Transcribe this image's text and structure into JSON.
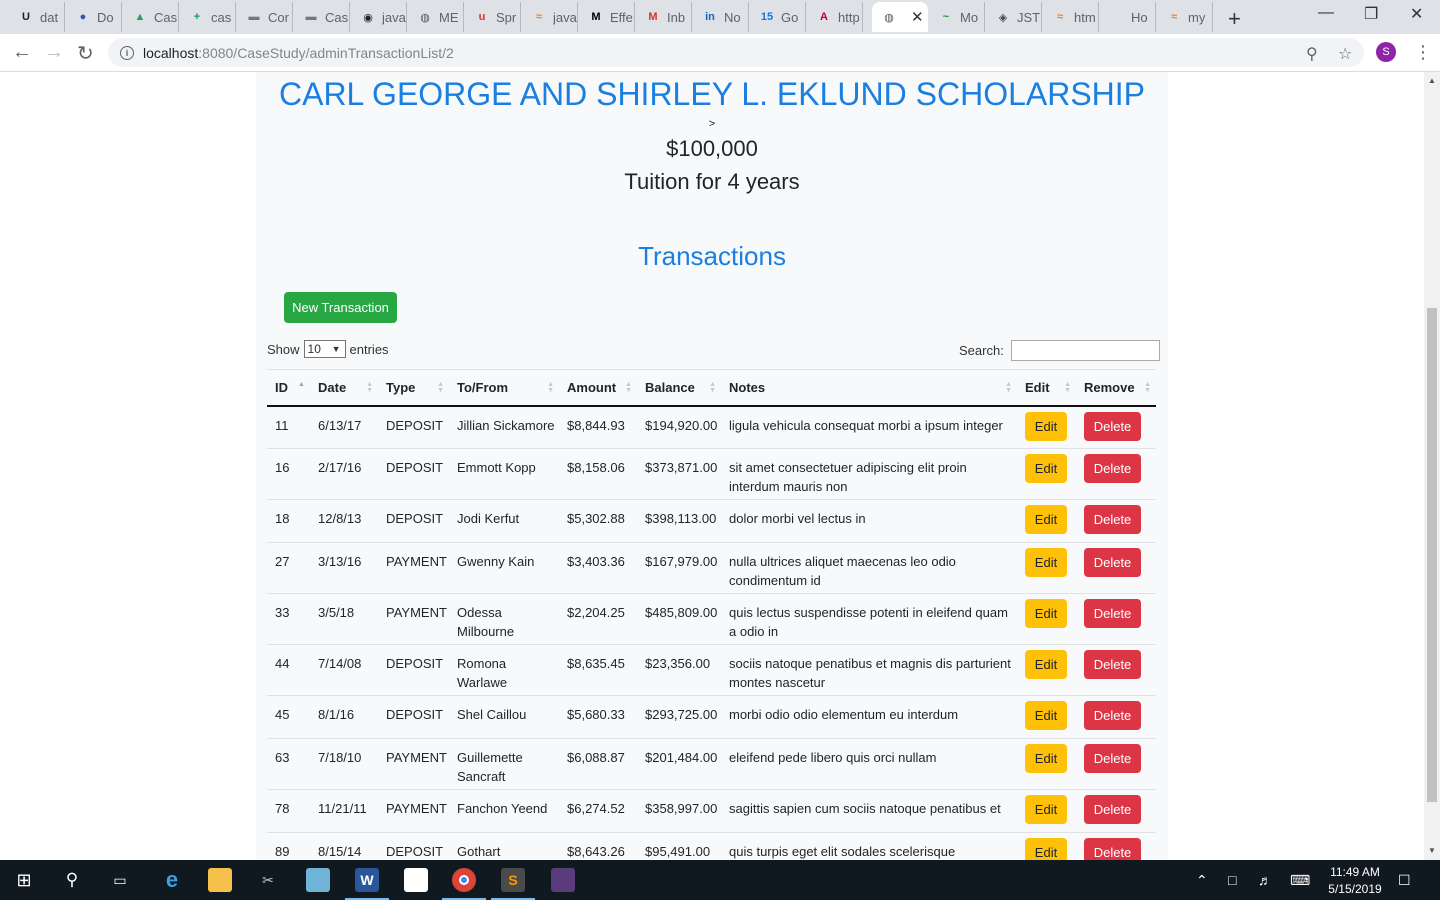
{
  "browser": {
    "tabs": [
      {
        "title": "dat",
        "icon": "U",
        "color": "#222222"
      },
      {
        "title": "Do",
        "icon": "●",
        "color": "#3b4fb8"
      },
      {
        "title": "Cas",
        "icon": "▲",
        "color": "#1fa463"
      },
      {
        "title": "cas",
        "icon": "+",
        "color": "#0f9d58"
      },
      {
        "title": "Cor",
        "icon": "▬",
        "color": "#777777"
      },
      {
        "title": "Cas",
        "icon": "▬",
        "color": "#777777"
      },
      {
        "title": "java",
        "icon": "◉",
        "color": "#222222"
      },
      {
        "title": "ME",
        "icon": "◍",
        "color": "#555555"
      },
      {
        "title": "Spr",
        "icon": "u",
        "color": "#e0322a"
      },
      {
        "title": "java",
        "icon": "≈",
        "color": "#f48024"
      },
      {
        "title": "Effe",
        "icon": "M",
        "color": "#000000"
      },
      {
        "title": "Inb",
        "icon": "M",
        "color": "#d93025"
      },
      {
        "title": "No",
        "icon": "in",
        "color": "#0a66c2"
      },
      {
        "title": "Go",
        "icon": "15",
        "color": "#1a73e8"
      },
      {
        "title": "http",
        "icon": "A",
        "color": "#c3002f"
      },
      {
        "title": "",
        "icon": "◍",
        "color": "#555555",
        "active": true
      },
      {
        "title": "Mo",
        "icon": "~",
        "color": "#1a8f3c"
      },
      {
        "title": "JST",
        "icon": "◈",
        "color": "#444444"
      },
      {
        "title": "htm",
        "icon": "≈",
        "color": "#f48024"
      },
      {
        "title": "Ho",
        "icon": "",
        "color": "#555555"
      },
      {
        "title": "my",
        "icon": "≈",
        "color": "#f48024"
      }
    ],
    "url_host": "localhost",
    "url_path": ":8080/CaseStudy/adminTransactionList/2",
    "profile_initial": "S"
  },
  "scholarship": {
    "title": "CARL GEORGE AND SHIRLEY L. EKLUND SCHOLARSHIP",
    "caret": ">",
    "amount": "$100,000",
    "description": "Tuition for 4 years"
  },
  "transactions": {
    "heading": "Transactions",
    "new_button": "New Transaction",
    "show_label": "Show",
    "entries_value": "10",
    "entries_label": "entries",
    "search_label": "Search:",
    "search_value": "",
    "columns": [
      "ID",
      "Date",
      "Type",
      "To/From",
      "Amount",
      "Balance",
      "Notes",
      "Edit",
      "Remove"
    ],
    "edit_label": "Edit",
    "delete_label": "Delete",
    "rows": [
      {
        "id": "11",
        "date": "6/13/17",
        "type": "DEPOSIT",
        "party": "Jillian Sickamore",
        "amount": "$8,844.93",
        "balance": "$194,920.00",
        "notes": "ligula vehicula consequat morbi a ipsum integer"
      },
      {
        "id": "16",
        "date": "2/17/16",
        "type": "DEPOSIT",
        "party": "Emmott Kopp",
        "amount": "$8,158.06",
        "balance": "$373,871.00",
        "notes": "sit amet consectetuer adipiscing elit proin interdum mauris non"
      },
      {
        "id": "18",
        "date": "12/8/13",
        "type": "DEPOSIT",
        "party": "Jodi Kerfut",
        "amount": "$5,302.88",
        "balance": "$398,113.00",
        "notes": "dolor morbi vel lectus in"
      },
      {
        "id": "27",
        "date": "3/13/16",
        "type": "PAYMENT",
        "party": "Gwenny Kain",
        "amount": "$3,403.36",
        "balance": "$167,979.00",
        "notes": "nulla ultrices aliquet maecenas leo odio condimentum id"
      },
      {
        "id": "33",
        "date": "3/5/18",
        "type": "PAYMENT",
        "party": "Odessa Milbourne",
        "amount": "$2,204.25",
        "balance": "$485,809.00",
        "notes": "quis lectus suspendisse potenti in eleifend quam a odio in"
      },
      {
        "id": "44",
        "date": "7/14/08",
        "type": "DEPOSIT",
        "party": "Romona Warlawe",
        "amount": "$8,635.45",
        "balance": "$23,356.00",
        "notes": "sociis natoque penatibus et magnis dis parturient montes nascetur"
      },
      {
        "id": "45",
        "date": "8/1/16",
        "type": "DEPOSIT",
        "party": "Shel Caillou",
        "amount": "$5,680.33",
        "balance": "$293,725.00",
        "notes": "morbi odio odio elementum eu interdum"
      },
      {
        "id": "63",
        "date": "7/18/10",
        "type": "PAYMENT",
        "party": "Guillemette Sancraft",
        "amount": "$6,088.87",
        "balance": "$201,484.00",
        "notes": "eleifend pede libero quis orci nullam"
      },
      {
        "id": "78",
        "date": "11/21/11",
        "type": "PAYMENT",
        "party": "Fanchon Yeend",
        "amount": "$6,274.52",
        "balance": "$358,997.00",
        "notes": "sagittis sapien cum sociis natoque penatibus et"
      },
      {
        "id": "89",
        "date": "8/15/14",
        "type": "DEPOSIT",
        "party": "Gothart",
        "amount": "$8,643.26",
        "balance": "$95,491.00",
        "notes": "quis turpis eget elit sodales scelerisque"
      }
    ]
  },
  "taskbar": {
    "time": "11:49 AM",
    "date": "5/15/2019"
  }
}
